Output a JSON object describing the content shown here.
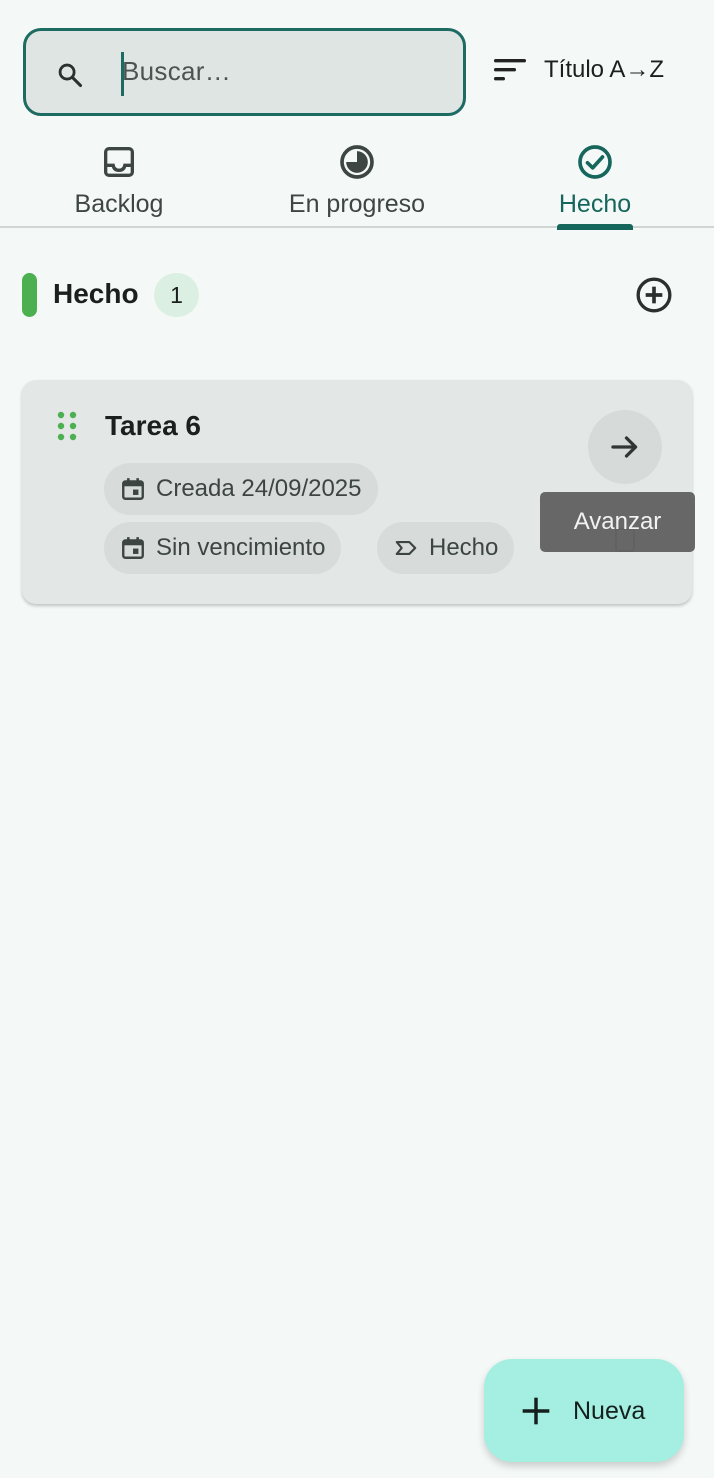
{
  "search": {
    "placeholder": "Buscar…",
    "icon": "search-icon"
  },
  "sort": {
    "label": "Título A→Z",
    "icon": "sort-icon"
  },
  "tabs": [
    {
      "label": "Backlog",
      "icon": "inbox-icon",
      "active": false
    },
    {
      "label": "En progreso",
      "icon": "progress-icon",
      "active": false
    },
    {
      "label": "Hecho",
      "icon": "check-circle-icon",
      "active": true
    }
  ],
  "column": {
    "title": "Hecho",
    "count": "1",
    "accent": "#4caf50",
    "add_icon": "add-circle-icon"
  },
  "cards": [
    {
      "title": "Tarea 6",
      "created": "Creada 24/09/2025",
      "due": "Sin vencimiento",
      "status": "Hecho"
    }
  ],
  "tooltip": {
    "text": "Avanzar"
  },
  "fab": {
    "label": "Nueva",
    "icon": "plus-icon"
  },
  "colors": {
    "primary": "#16665c",
    "background": "#f4f9f7",
    "fab": "#a4efe1"
  }
}
